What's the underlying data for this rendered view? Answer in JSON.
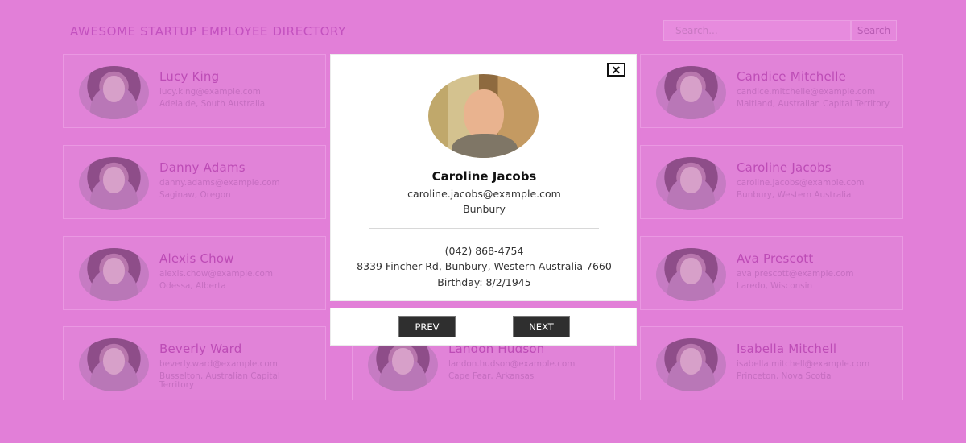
{
  "header": {
    "title": "AWESOME STARTUP EMPLOYEE DIRECTORY",
    "search_placeholder": "Search...",
    "search_button": "Search"
  },
  "employees": [
    {
      "name": "Lucy King",
      "email": "lucy.king@example.com",
      "location": "Adelaide, South Australia"
    },
    {
      "name": "Danny Adams",
      "email": "danny.adams@example.com",
      "location": "Saginaw, Oregon"
    },
    {
      "name": "Alexis Chow",
      "email": "alexis.chow@example.com",
      "location": "Odessa, Alberta"
    },
    {
      "name": "Beverly Ward",
      "email": "beverly.ward@example.com",
      "location": "Busselton, Australian Capital Territory"
    },
    {
      "name": "Landon Hudson",
      "email": "landon.hudson@example.com",
      "location": "Cape Fear, Arkansas"
    },
    {
      "name": "Candice Mitchelle",
      "email": "candice.mitchelle@example.com",
      "location": "Maitland, Australian Capital Territory"
    },
    {
      "name": "Caroline Jacobs",
      "email": "caroline.jacobs@example.com",
      "location": "Bunbury, Western Australia"
    },
    {
      "name": "Ava Prescott",
      "email": "ava.prescott@example.com",
      "location": "Laredo, Wisconsin"
    },
    {
      "name": "Isabella Mitchell",
      "email": "isabella.mitchell@example.com",
      "location": "Princeton, Nova Scotia"
    }
  ],
  "modal": {
    "close_label": "✕",
    "name": "Caroline Jacobs",
    "email": "caroline.jacobs@example.com",
    "city": "Bunbury",
    "phone": "(042) 868-4754",
    "address": "8339 Fincher Rd, Bunbury, Western Australia 7660",
    "birthday": "Birthday: 8/2/1945",
    "prev_label": "PREV",
    "next_label": "NEXT"
  },
  "colors": {
    "overlay_bg": "#e27fd8",
    "title": "#c351bf",
    "modal_bg": "#ffffff",
    "nav_button": "#2f2f2f"
  }
}
